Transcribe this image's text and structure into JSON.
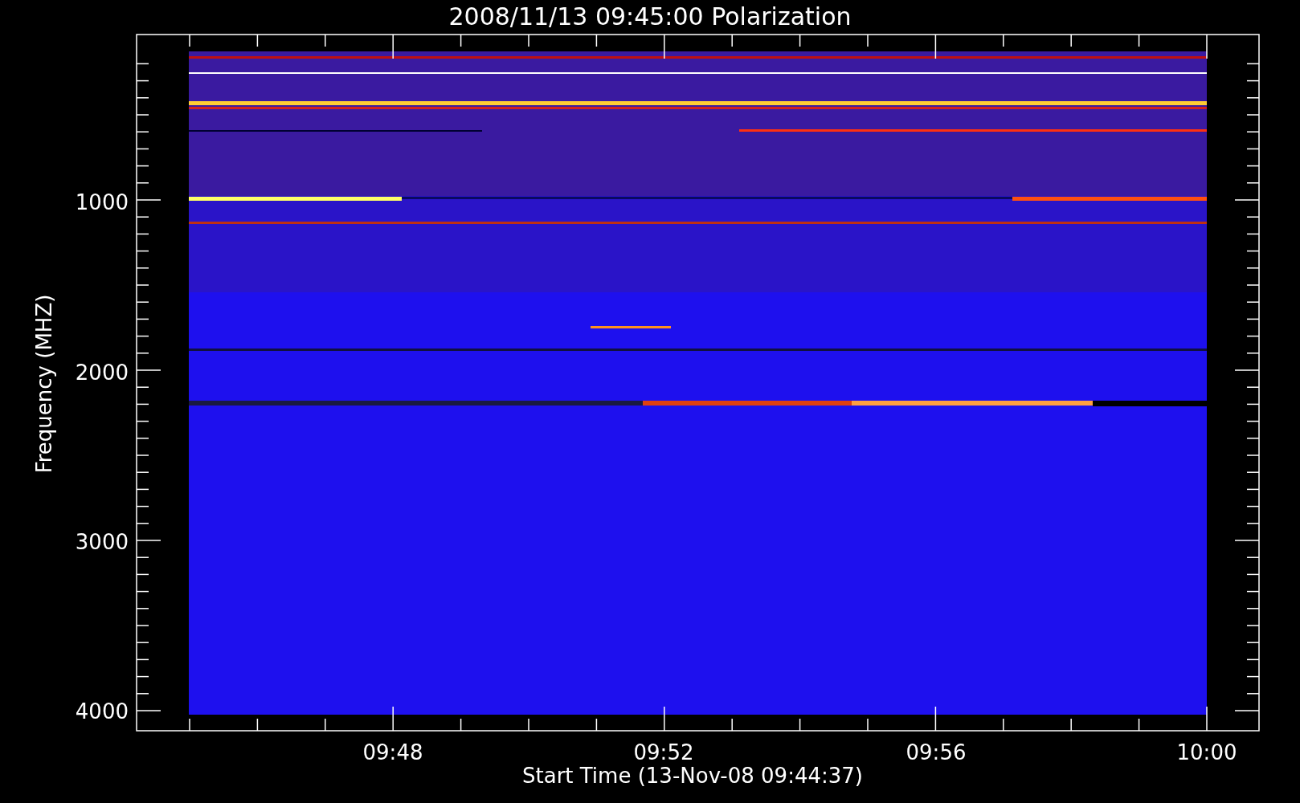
{
  "title": "2008/11/13 09:45:00 Polarization",
  "y_axis": {
    "label": "Frequency (MHZ)",
    "ticks": [
      "1000",
      "2000",
      "3000",
      "4000"
    ]
  },
  "x_axis": {
    "label": "Start Time (13-Nov-08 09:44:37)",
    "ticks": [
      "09:48",
      "09:52",
      "09:56",
      "10:00"
    ]
  }
}
